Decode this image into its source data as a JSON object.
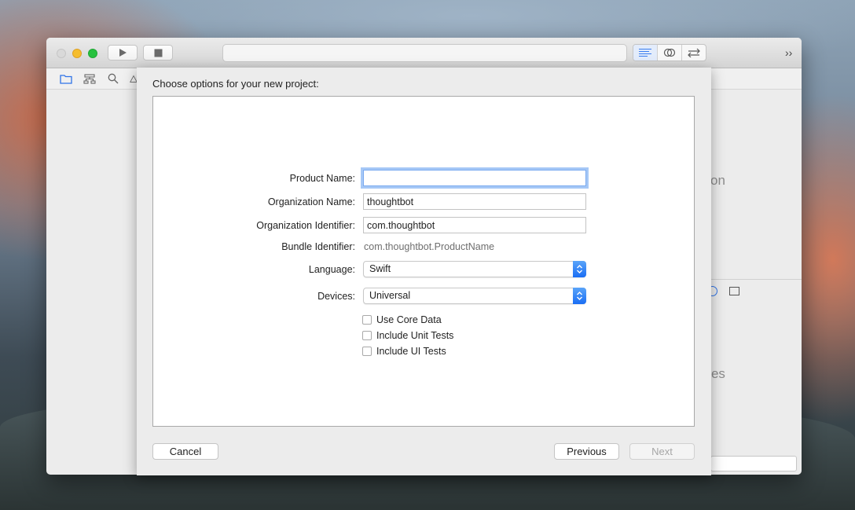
{
  "dialog": {
    "title": "Choose options for your new project:",
    "fields": {
      "product_name": {
        "label": "Product Name:",
        "value": ""
      },
      "organization_name": {
        "label": "Organization Name:",
        "value": "thoughtbot"
      },
      "organization_identifier": {
        "label": "Organization Identifier:",
        "value": "com.thoughtbot"
      },
      "bundle_identifier": {
        "label": "Bundle Identifier:",
        "value": "com.thoughtbot.ProductName"
      },
      "language": {
        "label": "Language:",
        "value": "Swift"
      },
      "devices": {
        "label": "Devices:",
        "value": "Universal"
      }
    },
    "checkboxes": [
      {
        "label": "Use Core Data",
        "checked": false
      },
      {
        "label": "Include Unit Tests",
        "checked": false
      },
      {
        "label": "Include UI Tests",
        "checked": false
      }
    ],
    "buttons": {
      "cancel": "Cancel",
      "previous": "Previous",
      "next": "Next"
    }
  },
  "background_window": {
    "partial_text_1": "ction",
    "partial_text_2": "ches"
  },
  "colors": {
    "accent": "#1a6ef4",
    "focus_ring": "#a6c8f6",
    "traffic_close": "#d9d9d9",
    "traffic_minimize": "#f5bd2e",
    "traffic_zoom": "#27c13f"
  },
  "icons": {
    "run": "play-icon",
    "stop": "stop-icon",
    "editor_standard": "standard-editor-icon",
    "editor_assistant": "assistant-editor-icon",
    "editor_version": "version-editor-icon",
    "overflow": "chevron-double-right-icon",
    "navigator_project": "folder-icon",
    "navigator_symbol": "hierarchy-icon",
    "navigator_find": "search-icon",
    "navigator_issue": "warning-icon"
  }
}
